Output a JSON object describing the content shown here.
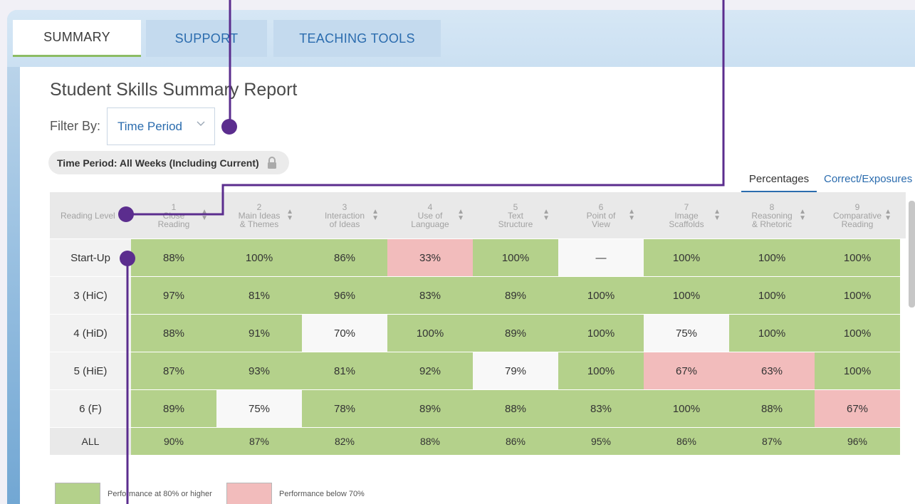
{
  "tabs": [
    {
      "label": "SUMMARY",
      "active": true
    },
    {
      "label": "SUPPORT",
      "active": false
    },
    {
      "label": "TEACHING TOOLS",
      "active": false
    }
  ],
  "report": {
    "title": "Student Skills Summary Report"
  },
  "filter": {
    "label": "Filter By:",
    "selected": "Time Period"
  },
  "chip": {
    "text": "Time Period: All Weeks (Including Current)"
  },
  "view_toggle": {
    "percentages": "Percentages",
    "correct_exposures": "Correct/Exposures"
  },
  "table": {
    "level_header": "Reading Level",
    "skills": [
      {
        "num": "1",
        "line1": "Close",
        "line2": "Reading"
      },
      {
        "num": "2",
        "line1": "Main Ideas",
        "line2": "& Themes"
      },
      {
        "num": "3",
        "line1": "Interaction",
        "line2": "of Ideas"
      },
      {
        "num": "4",
        "line1": "Use of",
        "line2": "Language"
      },
      {
        "num": "5",
        "line1": "Text",
        "line2": "Structure"
      },
      {
        "num": "6",
        "line1": "Point of",
        "line2": "View"
      },
      {
        "num": "7",
        "line1": "Image",
        "line2": "Scaffolds"
      },
      {
        "num": "8",
        "line1": "Reasoning",
        "line2": "& Rhetoric"
      },
      {
        "num": "9",
        "line1": "Comparative",
        "line2": "Reading"
      }
    ],
    "rows": [
      {
        "level": "Start-Up",
        "values": [
          "88%",
          "100%",
          "86%",
          "33%",
          "100%",
          "—",
          "100%",
          "100%",
          "100%"
        ],
        "status": [
          "g",
          "g",
          "g",
          "p",
          "g",
          "w",
          "g",
          "g",
          "g"
        ]
      },
      {
        "level": "3 (HiC)",
        "values": [
          "97%",
          "81%",
          "96%",
          "83%",
          "89%",
          "100%",
          "100%",
          "100%",
          "100%"
        ],
        "status": [
          "g",
          "g",
          "g",
          "g",
          "g",
          "g",
          "g",
          "g",
          "g"
        ]
      },
      {
        "level": "4 (HiD)",
        "values": [
          "88%",
          "91%",
          "70%",
          "100%",
          "89%",
          "100%",
          "75%",
          "100%",
          "100%"
        ],
        "status": [
          "g",
          "g",
          "w",
          "g",
          "g",
          "g",
          "w",
          "g",
          "g"
        ]
      },
      {
        "level": "5 (HiE)",
        "values": [
          "87%",
          "93%",
          "81%",
          "92%",
          "79%",
          "100%",
          "67%",
          "63%",
          "100%"
        ],
        "status": [
          "g",
          "g",
          "g",
          "g",
          "w",
          "g",
          "p",
          "p",
          "g"
        ]
      },
      {
        "level": "6 (F)",
        "values": [
          "89%",
          "75%",
          "78%",
          "89%",
          "88%",
          "83%",
          "100%",
          "88%",
          "67%"
        ],
        "status": [
          "g",
          "w",
          "g",
          "g",
          "g",
          "g",
          "g",
          "g",
          "p"
        ]
      },
      {
        "level": "ALL",
        "values": [
          "90%",
          "87%",
          "82%",
          "88%",
          "86%",
          "95%",
          "86%",
          "87%",
          "96%"
        ],
        "status": [
          "g",
          "g",
          "g",
          "g",
          "g",
          "g",
          "g",
          "g",
          "g"
        ]
      }
    ]
  },
  "legend": {
    "green_label": "Performance at 80% or higher",
    "pink_label": "Performance below 70%"
  },
  "colors": {
    "green": "#b4d18b",
    "pink": "#f2bcbc",
    "accent": "#2b6cae",
    "callout": "#5b2d8e"
  },
  "icons": {
    "lock": "lock-icon",
    "chevron": "chevron-down-icon",
    "sort": "sort-icon"
  }
}
